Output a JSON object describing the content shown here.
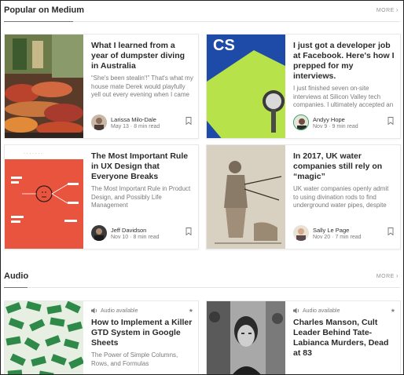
{
  "popular": {
    "title": "Popular on Medium",
    "more": "MORE",
    "cards": [
      {
        "title": "What I learned from a year of dumpster diving in Australia",
        "snippet": "“She's been stealin'!” That's what my house mate Derek would playfully yell out every evening when I came home…",
        "author": "Larissa Milo-Dale",
        "date": "May 13",
        "sep": "·",
        "read": "8 min read",
        "image": "vegetables",
        "avatar": "larissa-avatar"
      },
      {
        "title": "I just got a developer job at Facebook. Here's how I prepped for my interviews.",
        "snippet": "I just finished seven on-site interviews at Silicon Valley tech companies. I ultimately accepted an offer for a…",
        "author": "Andyy Hope",
        "date": "Nov 9",
        "sep": "·",
        "read": "9 min read",
        "image": "book-and-watch",
        "avatar": "andyy-avatar"
      },
      {
        "title": "The Most Important Rule in UX Design that Everyone Breaks",
        "snippet": "The Most Important Rule in Product Design, and Possibly Life Management",
        "author": "Jeff Davidson",
        "date": "Nov 10",
        "sep": "·",
        "read": "8 min read",
        "image": "ux-illustration",
        "avatar": "jeff-avatar"
      },
      {
        "title": "In 2017, UK water companies still rely on “magic”",
        "snippet": "UK water companies openly admit to using divination rods to find underground water pipes, despite no…",
        "author": "Sally Le Page",
        "date": "Nov 20",
        "sep": "·",
        "read": "7 min read",
        "image": "dowsing-engraving",
        "avatar": "sally-avatar"
      }
    ]
  },
  "audio": {
    "title": "Audio",
    "more": "MORE",
    "cards": [
      {
        "badge": "Audio available",
        "title": "How to Implement a Killer GTD System in Google Sheets",
        "snippet": "The Power of Simple Columns, Rows, and Formulas",
        "image": "money-pattern"
      },
      {
        "badge": "Audio available",
        "title": "Charles Manson, Cult Leader Behind Tate-Labianca Murders, Dead at 83",
        "snippet": "",
        "image": "manson-photo"
      }
    ]
  },
  "colors": {
    "text": "#292929",
    "muted": "#757575",
    "ux_red": "#e9543f",
    "accent_green": "#a8d64a"
  }
}
